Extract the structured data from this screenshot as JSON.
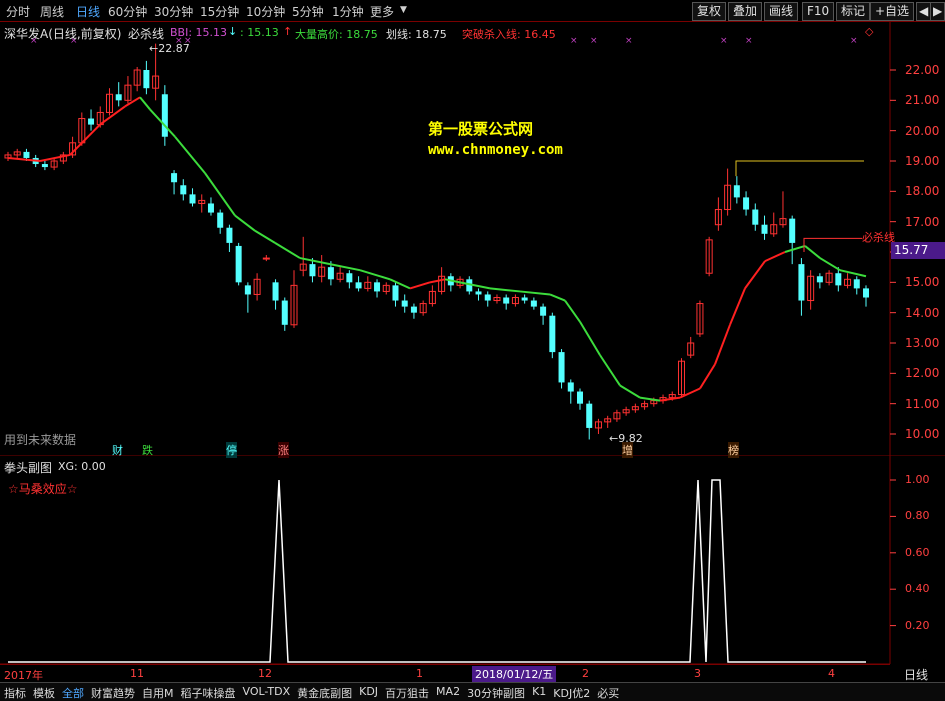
{
  "toolbar": {
    "tabs": [
      "分时",
      "周线",
      "日线",
      "60分钟",
      "30分钟",
      "15分钟",
      "10分钟",
      "5分钟",
      "1分钟",
      "更多"
    ],
    "more_arrow": "▼",
    "right_buttons": [
      "复权",
      "叠加",
      "画线",
      "F10",
      "标记",
      "+自选"
    ],
    "nav": [
      "◀",
      "▶"
    ]
  },
  "main": {
    "stock_title": "深华发A(日线,前复权)",
    "indicator_name": "必杀线",
    "bbi_label": "BBI: 15.13",
    "bbi_down": "↓",
    "bbi_value2": ": 15.13",
    "volume_label": "大量高价: 18.75",
    "volume_arrow": "↑",
    "line_label": "划线: 18.75",
    "breakout_label": "突破杀入线: 16.45",
    "watermark_title": "第一股票公式网",
    "watermark_url": "www.chnmoney.com",
    "future_data_note": "用到未来数据",
    "high_marker": "22.87",
    "low_marker": "9.82",
    "kill_line_label": "必杀线",
    "current_price": "15.77",
    "price_ticks": [
      "22.00",
      "21.00",
      "20.00",
      "19.00",
      "18.00",
      "17.00",
      "16.00",
      "15.00",
      "14.00",
      "13.00",
      "12.00",
      "11.00",
      "10.00"
    ],
    "event_markers": [
      "财",
      "跌",
      "停",
      "涨",
      "增",
      "榜"
    ],
    "diamond_icon": "◇",
    "colors": {
      "up": "#ff3232",
      "down": "#54ffff",
      "ma_green": "#3cdc3c",
      "ma_red": "#ff2020",
      "accent_yellow": "#ffff00"
    }
  },
  "sub": {
    "title": "拳头副图",
    "xg_label": "XG: 0.00",
    "effect_label": "☆马桑效应☆",
    "y_ticks": [
      "1.00",
      "0.80",
      "0.60",
      "0.40",
      "0.20"
    ]
  },
  "timeline": {
    "labels": [
      "2017年",
      "11",
      "12",
      "1",
      "2018/01/12/五",
      "2",
      "3",
      "4"
    ],
    "period": "日线"
  },
  "bottom_tabs": [
    "指标",
    "模板",
    "全部",
    "财富趋势",
    "自用M",
    "稻子味操盘",
    "VOL-TDX",
    "黄金底副图",
    "KDJ",
    "百万狙击",
    "MA2",
    "30分钟副图",
    "K1",
    "KDJ优2",
    "必买"
  ]
}
